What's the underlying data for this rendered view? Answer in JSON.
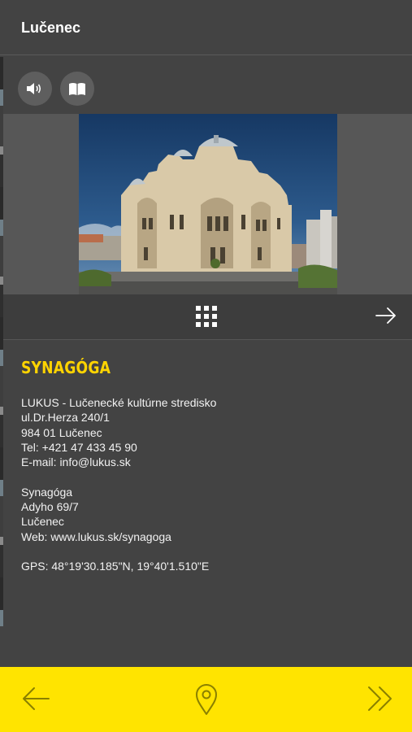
{
  "header": {
    "title": "Lučenec"
  },
  "actions": [
    {
      "icon": "speaker-icon"
    },
    {
      "icon": "book-icon"
    }
  ],
  "gallery": {
    "icons": {
      "grid": "grid-icon",
      "next": "arrow-right-icon"
    }
  },
  "detail": {
    "heading": "SYNAGÓGA",
    "organizer_lines": [
      "LUKUS - Lučenecké kultúrne stredisko",
      "ul.Dr.Herza 240/1",
      "984 01 Lučenec",
      "Tel: +421 47 433 45 90",
      "E-mail: info@lukus.sk"
    ],
    "venue_lines": [
      "Synagóga",
      "Adyho 69/7",
      "Lučenec",
      "Web: www.lukus.sk/synagoga"
    ],
    "gps": "GPS: 48°19'30.185\"N, 19°40'1.510\"E"
  },
  "bottom_nav": [
    {
      "icon": "arrow-left-icon"
    },
    {
      "icon": "map-pin-icon"
    },
    {
      "icon": "double-chevron-right-icon"
    }
  ],
  "colors": {
    "accent": "#ffe400",
    "heading": "#ffd400",
    "background": "#434343"
  }
}
